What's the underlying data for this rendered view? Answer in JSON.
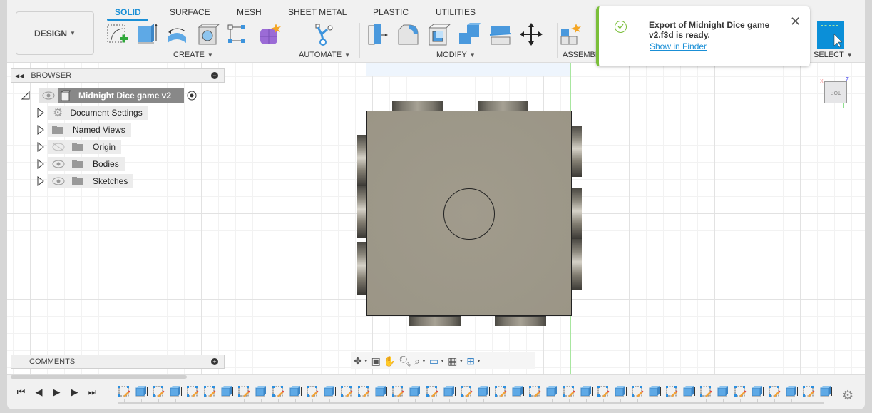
{
  "toolbar": {
    "workspace_button": "DESIGN",
    "tabs": [
      {
        "label": "SOLID",
        "active": true
      },
      {
        "label": "SURFACE",
        "active": false
      },
      {
        "label": "MESH",
        "active": false
      },
      {
        "label": "SHEET METAL",
        "active": false
      },
      {
        "label": "PLASTIC",
        "active": false
      },
      {
        "label": "UTILITIES",
        "active": false
      }
    ],
    "groups": {
      "create": "CREATE",
      "automate": "AUTOMATE",
      "modify": "MODIFY",
      "assemble": "ASSEMBL",
      "select": "SELECT"
    },
    "create_tools": [
      "create-sketch-icon",
      "extrude-icon",
      "revolve-icon",
      "hole-icon",
      "pattern-icon",
      "create-form-icon"
    ],
    "automate_tools": [
      "automate-icon"
    ],
    "modify_tools": [
      "press-pull-icon",
      "fillet-icon",
      "shell-icon",
      "combine-icon",
      "split-body-icon",
      "move-icon"
    ],
    "assemble_tools": [
      "new-component-icon"
    ]
  },
  "browser": {
    "title": "BROWSER",
    "root": "Midnight Dice game v2",
    "items": [
      {
        "label": "Document Settings",
        "icon": "gear-icon",
        "visibility": "none"
      },
      {
        "label": "Named Views",
        "icon": "folder-icon",
        "visibility": "none"
      },
      {
        "label": "Origin",
        "icon": "folder-icon",
        "visibility": "hidden"
      },
      {
        "label": "Bodies",
        "icon": "folder-icon",
        "visibility": "visible"
      },
      {
        "label": "Sketches",
        "icon": "folder-icon",
        "visibility": "visible"
      }
    ]
  },
  "comments": {
    "title": "COMMENTS"
  },
  "viewcube": {
    "face_label": "TOP",
    "axis_x": "X",
    "axis_z": "Z"
  },
  "toast": {
    "message": "Export of Midnight Dice game v2.f3d is ready.",
    "link": "Show in Finder",
    "accent_color": "#7bbf3a"
  },
  "navbar": {
    "tools": [
      "orbit-icon",
      "look-at-icon",
      "pan-icon",
      "zoom-icon",
      "fit-icon",
      "display-settings-icon",
      "grid-icon",
      "viewports-icon"
    ]
  },
  "timeline": {
    "controls": [
      "go-to-start",
      "step-back",
      "play",
      "step-forward",
      "go-to-end"
    ],
    "features": [
      "sketch",
      "extrude",
      "sketch",
      "extrude",
      "sketch",
      "sketch",
      "extrude",
      "sketch",
      "extrude",
      "sketch",
      "extrude",
      "sketch",
      "extrude",
      "sketch",
      "sketch",
      "extrude",
      "sketch",
      "extrude",
      "sketch",
      "extrude",
      "sketch",
      "extrude",
      "sketch",
      "extrude",
      "sketch",
      "extrude",
      "sketch",
      "extrude",
      "sketch",
      "extrude",
      "sketch",
      "extrude",
      "sketch",
      "extrude",
      "sketch",
      "extrude",
      "sketch",
      "extrude",
      "sketch",
      "extrude",
      "sketch",
      "extrude"
    ]
  },
  "colors": {
    "accent": "#1a8fd6",
    "body": "#9d9889"
  }
}
